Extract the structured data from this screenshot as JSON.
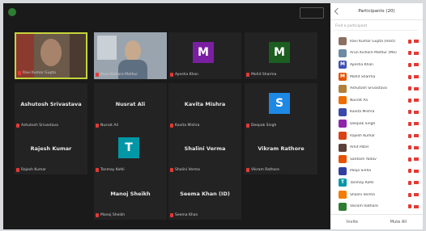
{
  "colors": {
    "panel_bg": "#ffffff",
    "stage_bg": "#1a1a1a",
    "tile_bg": "#232323",
    "active_border": "#c6d43a",
    "muted": "#e53935"
  },
  "participants_panel": {
    "title": "Participants (20)",
    "search_placeholder": "Find a participant",
    "list": [
      {
        "initial": "",
        "color": "#8d6e63",
        "name": "Ravi Kumar Gupta (Host)"
      },
      {
        "initial": "",
        "color": "#6d8ba3",
        "name": "Arun Kishore Mathur (Me)"
      },
      {
        "initial": "M",
        "color": "#3f51b5",
        "name": "Ayesha Khan"
      },
      {
        "initial": "M",
        "color": "#e65100",
        "name": "Mohit Sharma"
      },
      {
        "initial": "",
        "color": "#b0803a",
        "name": "Ashutosh Srivastava"
      },
      {
        "initial": "",
        "color": "#ef6c00",
        "name": "Nusrat Ali"
      },
      {
        "initial": "",
        "color": "#3949ab",
        "name": "Kavita Mishra"
      },
      {
        "initial": "",
        "color": "#8e24aa",
        "name": "Deepak Singh"
      },
      {
        "initial": "",
        "color": "#d84315",
        "name": "Rajesh Kumar"
      },
      {
        "initial": "",
        "color": "#5d4037",
        "name": "Amit Patel"
      },
      {
        "initial": "",
        "color": "#e65100",
        "name": "Santosh Yadav"
      },
      {
        "initial": "",
        "color": "#303f9f",
        "name": "Pooja Sinha"
      },
      {
        "initial": "T",
        "color": "#0097a7",
        "name": "Tanmay Kohli"
      },
      {
        "initial": "",
        "color": "#f57c00",
        "name": "Shalini Verma"
      },
      {
        "initial": "",
        "color": "#2e7d32",
        "name": "Vikram Rathore"
      }
    ],
    "footer": {
      "left": "Invite",
      "right": "Mute All"
    }
  },
  "tiles": [
    {
      "type": "video-a",
      "caption": "Ravi Kumar Gupta",
      "active": true
    },
    {
      "type": "video-b",
      "caption": "Arun Kishore Mathur"
    },
    {
      "type": "avatar",
      "initial": "M",
      "color": "#7b1fa2",
      "caption": "Ayesha Khan"
    },
    {
      "type": "avatar",
      "initial": "M",
      "color": "#1b5e20",
      "caption": "Mohit Sharma"
    },
    {
      "type": "name",
      "name": "Ashutosh Srivastava",
      "caption": "Ashutosh Srivastava"
    },
    {
      "type": "name",
      "name": "Nusrat Ali",
      "caption": "Nusrat Ali"
    },
    {
      "type": "name",
      "name": "Kavita Mishra",
      "caption": "Kavita Mishra"
    },
    {
      "type": "avatar",
      "initial": "S",
      "color": "#1e88e5",
      "caption": "Deepak Singh"
    },
    {
      "type": "name",
      "name": "Rajesh Kumar",
      "caption": "Rajesh Kumar"
    },
    {
      "type": "avatar",
      "initial": "T",
      "color": "#0097a7",
      "caption": "Tanmay Kohli"
    },
    {
      "type": "name",
      "name": "Shalini Verma",
      "caption": "Shalini Verma"
    },
    {
      "type": "name",
      "name": "Vikram Rathore",
      "caption": "Vikram Rathore"
    },
    {
      "type": "name",
      "name": "Manoj Sheikh",
      "caption": "Manoj Sheikh"
    },
    {
      "type": "name",
      "name": "Seema Khan (ID)",
      "caption": "Seema Khan"
    }
  ]
}
